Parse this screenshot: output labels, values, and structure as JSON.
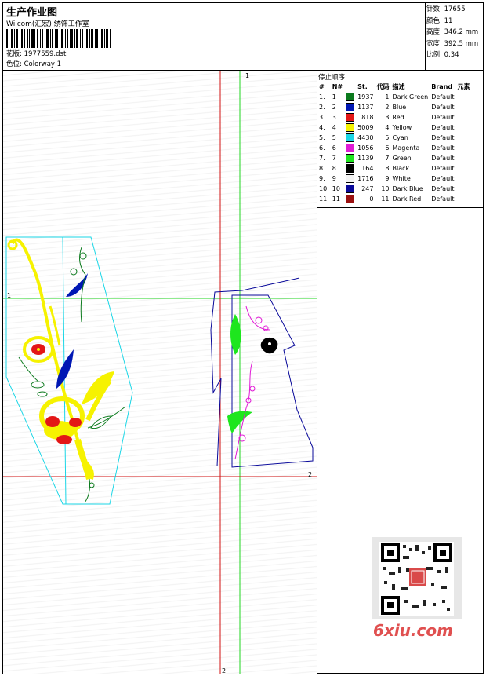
{
  "header": {
    "title": "生产作业图",
    "organization": "Wilcom(汇宏) 绣饰工作室",
    "design_label": "花版:",
    "design_value": "1977559.dst",
    "colorway_label": "色位:",
    "colorway_value": "Colorway 1"
  },
  "stats": {
    "stitches_label": "针数:",
    "stitches": "17655",
    "colors_label": "颜色:",
    "colors": "11",
    "height_label": "高度:",
    "height": "346.2 mm",
    "width_label": "宽度:",
    "width": "392.5 mm",
    "scale_label": "比例:",
    "scale": "0.34"
  },
  "stop_sequence": {
    "title": "停止顺序:",
    "columns": [
      "#",
      "N#",
      "St.",
      "代码",
      "描述",
      "Brand",
      "元素"
    ],
    "rows": [
      {
        "idx": "1.",
        "n": "1",
        "st": "1937",
        "code": "1",
        "desc": "Dark Green",
        "brand": "Default",
        "color": "#0b7a1d"
      },
      {
        "idx": "2.",
        "n": "2",
        "st": "1137",
        "code": "2",
        "desc": "Blue",
        "brand": "Default",
        "color": "#0017b4"
      },
      {
        "idx": "3.",
        "n": "3",
        "st": "818",
        "code": "3",
        "desc": "Red",
        "brand": "Default",
        "color": "#e31616"
      },
      {
        "idx": "4.",
        "n": "4",
        "st": "5009",
        "code": "4",
        "desc": "Yellow",
        "brand": "Default",
        "color": "#f6f200"
      },
      {
        "idx": "5.",
        "n": "5",
        "st": "4430",
        "code": "5",
        "desc": "Cyan",
        "brand": "Default",
        "color": "#1ad6e6"
      },
      {
        "idx": "6.",
        "n": "6",
        "st": "1056",
        "code": "6",
        "desc": "Magenta",
        "brand": "Default",
        "color": "#e11ad6"
      },
      {
        "idx": "7.",
        "n": "7",
        "st": "1139",
        "code": "7",
        "desc": "Green",
        "brand": "Default",
        "color": "#1ee61e"
      },
      {
        "idx": "8.",
        "n": "8",
        "st": "164",
        "code": "8",
        "desc": "Black",
        "brand": "Default",
        "color": "#000000"
      },
      {
        "idx": "9.",
        "n": "9",
        "st": "1716",
        "code": "9",
        "desc": "White",
        "brand": "Default",
        "color": "#f4f4f4"
      },
      {
        "idx": "10.",
        "n": "10",
        "st": "247",
        "code": "10",
        "desc": "Dark Blue",
        "brand": "Default",
        "color": "#0a0a9a"
      },
      {
        "idx": "11.",
        "n": "11",
        "st": "0",
        "code": "11",
        "desc": "Dark Red",
        "brand": "Default",
        "color": "#9a1010"
      }
    ]
  },
  "canvas": {
    "guide_labels": {
      "v1": "1",
      "h1": "1",
      "h2": "2",
      "v2": "2"
    },
    "guide_colors": {
      "vertical_green": "#1fd41f",
      "horizontal_green": "#1fd41f",
      "red": "#d01010"
    }
  },
  "watermark": "6xiu.com"
}
